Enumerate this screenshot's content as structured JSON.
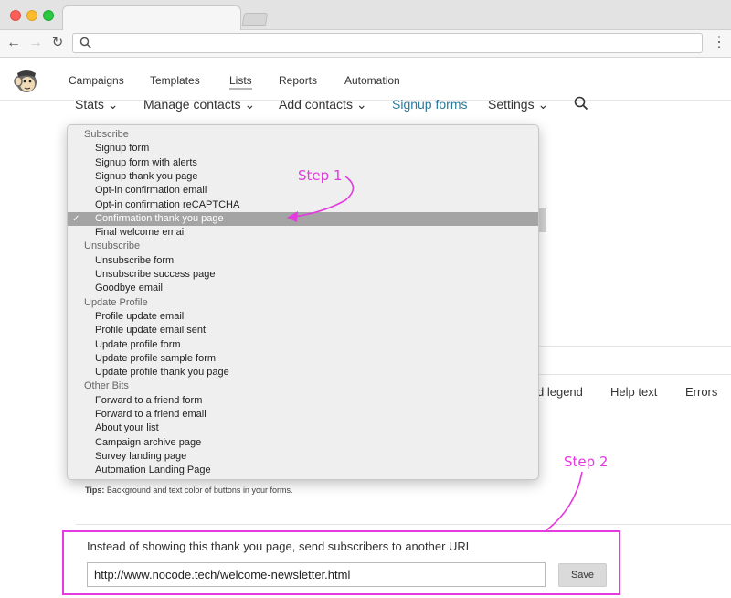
{
  "browser": {
    "url_value": ""
  },
  "app_nav": {
    "items": [
      "Campaigns",
      "Templates",
      "Lists",
      "Reports",
      "Automation"
    ]
  },
  "sub_nav": {
    "items": [
      "Stats",
      "Manage contacts",
      "Add contacts",
      "Signup forms",
      "Settings"
    ],
    "active": "Signup forms"
  },
  "dropdown": {
    "groups": [
      {
        "label": "Subscribe",
        "items": [
          "Signup form",
          "Signup form with alerts",
          "Signup thank you page",
          "Opt-in confirmation email",
          "Opt-in confirmation reCAPTCHA",
          "Confirmation thank you page",
          "Final welcome email"
        ]
      },
      {
        "label": "Unsubscribe",
        "items": [
          "Unsubscribe form",
          "Unsubscribe success page",
          "Goodbye email"
        ]
      },
      {
        "label": "Update Profile",
        "items": [
          "Profile update email",
          "Profile update email sent",
          "Update profile form",
          "Update profile sample form",
          "Update profile thank you page"
        ]
      },
      {
        "label": "Other Bits",
        "items": [
          "Forward to a friend form",
          "Forward to a friend email",
          "About your list",
          "Campaign archive page",
          "Survey landing page",
          "Automation Landing Page"
        ]
      }
    ],
    "selected": "Confirmation thank you page",
    "check_glyph": "✓"
  },
  "field_tabs": [
    "d legend",
    "Help text",
    "Errors"
  ],
  "tips": {
    "label": "Tips:",
    "text": " Background and text color of buttons in your forms."
  },
  "annotations": {
    "step1": "Step 1",
    "step2": "Step 2",
    "color": "#e43be0"
  },
  "redirect": {
    "label": "Instead of showing this thank you page, send subscribers to another URL",
    "url_value": "http://www.nocode.tech/welcome-newsletter.html",
    "save_label": "Save"
  },
  "icons": {
    "back": "back-arrow-icon",
    "forward": "forward-arrow-icon",
    "reload": "reload-icon",
    "search": "search-icon",
    "menu": "more-vertical-icon",
    "logo": "mailchimp-logo",
    "chevron": "chevron-down-icon"
  }
}
